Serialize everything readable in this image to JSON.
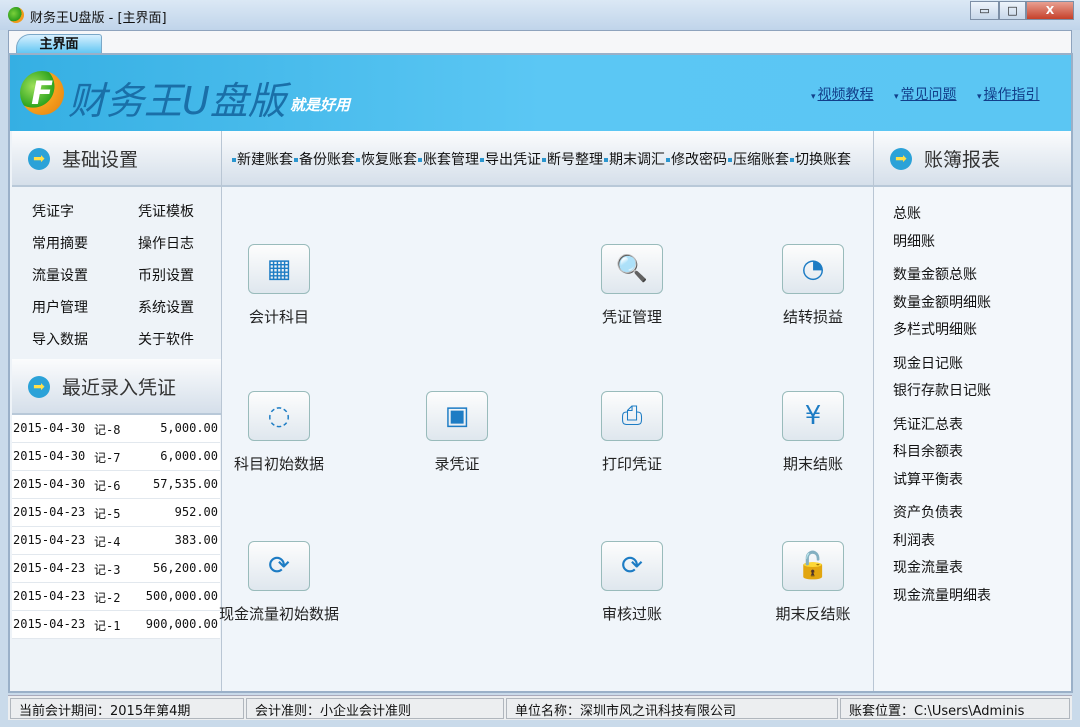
{
  "window": {
    "title": "财务王U盘版 - [主界面]",
    "minimize": "▭",
    "maximize": "□",
    "close": "X"
  },
  "tab": "主界面",
  "banner": {
    "logo_letter": "F",
    "brand": "财务王U盘版",
    "slogan": "就是好用",
    "links": [
      "视频教程",
      "常见问题",
      "操作指引"
    ]
  },
  "left": {
    "header": "基础设置",
    "settings": [
      [
        "凭证字",
        "凭证模板"
      ],
      [
        "常用摘要",
        "操作日志"
      ],
      [
        "流量设置",
        "币别设置"
      ],
      [
        "用户管理",
        "系统设置"
      ],
      [
        "导入数据",
        "关于软件"
      ]
    ],
    "recent_header": "最近录入凭证",
    "recent": [
      [
        "2015-04-30",
        "记-8",
        "5,000.00"
      ],
      [
        "2015-04-30",
        "记-7",
        "6,000.00"
      ],
      [
        "2015-04-30",
        "记-6",
        "57,535.00"
      ],
      [
        "2015-04-23",
        "记-5",
        "952.00"
      ],
      [
        "2015-04-23",
        "记-4",
        "383.00"
      ],
      [
        "2015-04-23",
        "记-3",
        "56,200.00"
      ],
      [
        "2015-04-23",
        "记-2",
        "500,000.00"
      ],
      [
        "2015-04-23",
        "记-1",
        "900,000.00"
      ]
    ]
  },
  "toolbar": [
    "新建账套",
    "备份账套",
    "恢复账套",
    "账套管理",
    "导出凭证",
    "断号整理",
    "期末调汇",
    "修改密码",
    "压缩账套",
    "切换账套"
  ],
  "functions": [
    {
      "label": "会计科目",
      "icon": "calendar-icon",
      "glyph": "▦"
    },
    {
      "label": "凭证管理",
      "icon": "voucher-search-icon",
      "glyph": "🔍"
    },
    {
      "label": "结转损益",
      "icon": "pie-chart-icon",
      "glyph": "◔"
    },
    {
      "label": "科目初始数据",
      "icon": "monitor-icon",
      "glyph": "◌"
    },
    {
      "label": "录凭证",
      "icon": "wallet-icon",
      "glyph": "▣"
    },
    {
      "label": "打印凭证",
      "icon": "printer-icon",
      "glyph": "⎙"
    },
    {
      "label": "期末结账",
      "icon": "yen-calendar-icon",
      "glyph": "¥"
    },
    {
      "label": "现金流量初始数据",
      "icon": "laptop-refresh-icon",
      "glyph": "⟳"
    },
    {
      "label": "审核过账",
      "icon": "calendar-refresh-icon",
      "glyph": "⟳"
    },
    {
      "label": "期末反结账",
      "icon": "unlock-icon",
      "glyph": "🔓"
    }
  ],
  "right": {
    "header": "账簿报表",
    "groups": [
      [
        "总账",
        "明细账"
      ],
      [
        "数量金额总账",
        "数量金额明细账",
        "多栏式明细账"
      ],
      [
        "现金日记账",
        "银行存款日记账"
      ],
      [
        "凭证汇总表",
        "科目余额表",
        "试算平衡表"
      ],
      [
        "资产负债表",
        "利润表",
        "现金流量表",
        "现金流量明细表"
      ]
    ]
  },
  "status": [
    "当前会计期间：2015年第4期",
    "会计准则：小企业会计准则",
    "单位名称：深圳市风之讯科技有限公司",
    "账套位置：C:\\Users\\Adminis"
  ]
}
